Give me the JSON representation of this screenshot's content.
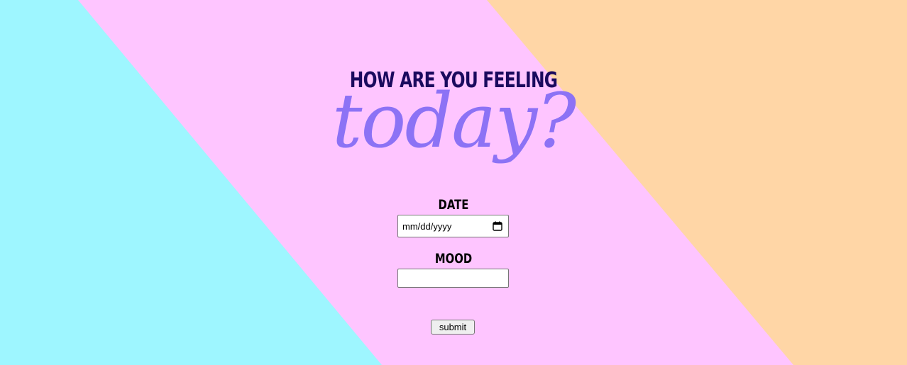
{
  "page": {
    "heading": "HOW ARE YOU FEELING",
    "script_word": "today?"
  },
  "form": {
    "date_label": "DATE",
    "date_placeholder": "mm/dd/yyyy",
    "mood_label": "MOOD",
    "mood_value": "",
    "submit_label": "submit"
  },
  "colors": {
    "cyan_panel": "#9ef6ff",
    "pink_panel": "#fec5ff",
    "peach_panel": "#ffd6a6",
    "heading": "#1a0a5e",
    "script_word": "#8c72f5"
  },
  "icons": {
    "date_picker": "calendar-icon"
  }
}
